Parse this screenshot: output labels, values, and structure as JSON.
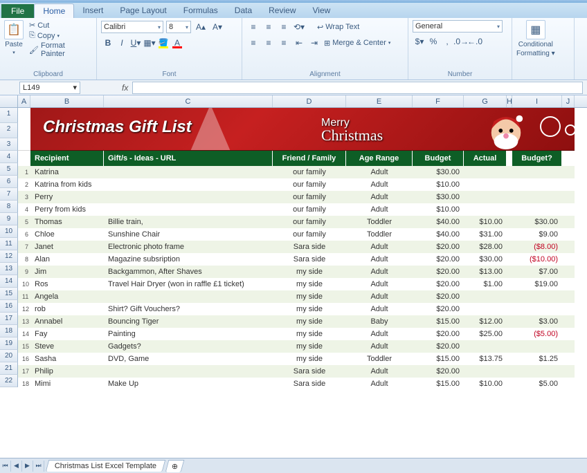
{
  "tabs": {
    "file": "File",
    "list": [
      "Home",
      "Insert",
      "Page Layout",
      "Formulas",
      "Data",
      "Review",
      "View"
    ],
    "active": 0
  },
  "ribbon": {
    "clipboard": {
      "paste": "Paste",
      "cut": "Cut",
      "copy": "Copy",
      "fmt": "Format Painter",
      "label": "Clipboard"
    },
    "font": {
      "name": "Calibri",
      "size": "8",
      "label": "Font"
    },
    "align": {
      "wrap": "Wrap Text",
      "merge": "Merge & Center",
      "label": "Alignment"
    },
    "number": {
      "fmt": "General",
      "label": "Number"
    },
    "styles": {
      "cond": "Conditional",
      "cond2": "Formatting",
      "label": ""
    }
  },
  "namebox": "L149",
  "banner": {
    "title": "Christmas Gift List",
    "merry": "Merry",
    "merry2": "Christmas"
  },
  "columns": {
    "letters": [
      "A",
      "B",
      "C",
      "D",
      "E",
      "F",
      "G",
      "H",
      "I",
      "J"
    ],
    "widths": [
      18,
      106,
      244,
      106,
      96,
      74,
      62,
      8,
      72,
      18
    ]
  },
  "headers": [
    "Recipient",
    "Gift/s - Ideas - URL",
    "Friend / Family",
    "Age Range",
    "Budget",
    "Actual",
    "Budget?"
  ],
  "rows": [
    {
      "n": 1,
      "r": "Katrina",
      "g": "",
      "f": "our family",
      "a": "Adult",
      "b": "$30.00",
      "ac": "",
      "bd": ""
    },
    {
      "n": 2,
      "r": "Katrina from kids",
      "g": "",
      "f": "our family",
      "a": "Adult",
      "b": "$10.00",
      "ac": "",
      "bd": ""
    },
    {
      "n": 3,
      "r": "Perry",
      "g": "",
      "f": "our family",
      "a": "Adult",
      "b": "$30.00",
      "ac": "",
      "bd": ""
    },
    {
      "n": 4,
      "r": "Perry from kids",
      "g": "",
      "f": "our family",
      "a": "Adult",
      "b": "$10.00",
      "ac": "",
      "bd": ""
    },
    {
      "n": 5,
      "r": "Thomas",
      "g": "Billie train,",
      "f": "our family",
      "a": "Toddler",
      "b": "$40.00",
      "ac": "$10.00",
      "bd": "$30.00"
    },
    {
      "n": 6,
      "r": "Chloe",
      "g": "Sunshine Chair",
      "f": "our family",
      "a": "Toddler",
      "b": "$40.00",
      "ac": "$31.00",
      "bd": "$9.00"
    },
    {
      "n": 7,
      "r": "Janet",
      "g": "Electronic photo frame",
      "f": "Sara side",
      "a": "Adult",
      "b": "$20.00",
      "ac": "$28.00",
      "bd": "($8.00)",
      "neg": true
    },
    {
      "n": 8,
      "r": "Alan",
      "g": "Magazine subsription",
      "f": "Sara side",
      "a": "Adult",
      "b": "$20.00",
      "ac": "$30.00",
      "bd": "($10.00)",
      "neg": true
    },
    {
      "n": 9,
      "r": "Jim",
      "g": "Backgammon, After Shaves",
      "f": "my side",
      "a": "Adult",
      "b": "$20.00",
      "ac": "$13.00",
      "bd": "$7.00"
    },
    {
      "n": 10,
      "r": "Ros",
      "g": "Travel Hair Dryer (won in raffle £1 ticket)",
      "f": "my side",
      "a": "Adult",
      "b": "$20.00",
      "ac": "$1.00",
      "bd": "$19.00"
    },
    {
      "n": 11,
      "r": "Angela",
      "g": "",
      "f": "my side",
      "a": "Adult",
      "b": "$20.00",
      "ac": "",
      "bd": ""
    },
    {
      "n": 12,
      "r": "rob",
      "g": "Shirt? Gift Vouchers?",
      "f": "my side",
      "a": "Adult",
      "b": "$20.00",
      "ac": "",
      "bd": ""
    },
    {
      "n": 13,
      "r": "Annabel",
      "g": "Bouncing Tiger",
      "f": "my side",
      "a": "Baby",
      "b": "$15.00",
      "ac": "$12.00",
      "bd": "$3.00"
    },
    {
      "n": 14,
      "r": "Fay",
      "g": "Painting",
      "f": "my side",
      "a": "Adult",
      "b": "$20.00",
      "ac": "$25.00",
      "bd": "($5.00)",
      "neg": true
    },
    {
      "n": 15,
      "r": "Steve",
      "g": "Gadgets?",
      "f": "my side",
      "a": "Adult",
      "b": "$20.00",
      "ac": "",
      "bd": ""
    },
    {
      "n": 16,
      "r": "Sasha",
      "g": "DVD, Game",
      "f": "my side",
      "a": "Toddler",
      "b": "$15.00",
      "ac": "$13.75",
      "bd": "$1.25"
    },
    {
      "n": 17,
      "r": "Philip",
      "g": "",
      "f": "Sara side",
      "a": "Adult",
      "b": "$20.00",
      "ac": "",
      "bd": ""
    },
    {
      "n": 18,
      "r": "Mimi",
      "g": "Make Up",
      "f": "Sara side",
      "a": "Adult",
      "b": "$15.00",
      "ac": "$10.00",
      "bd": "$5.00"
    }
  ],
  "sheetTab": "Christmas List Excel Template"
}
